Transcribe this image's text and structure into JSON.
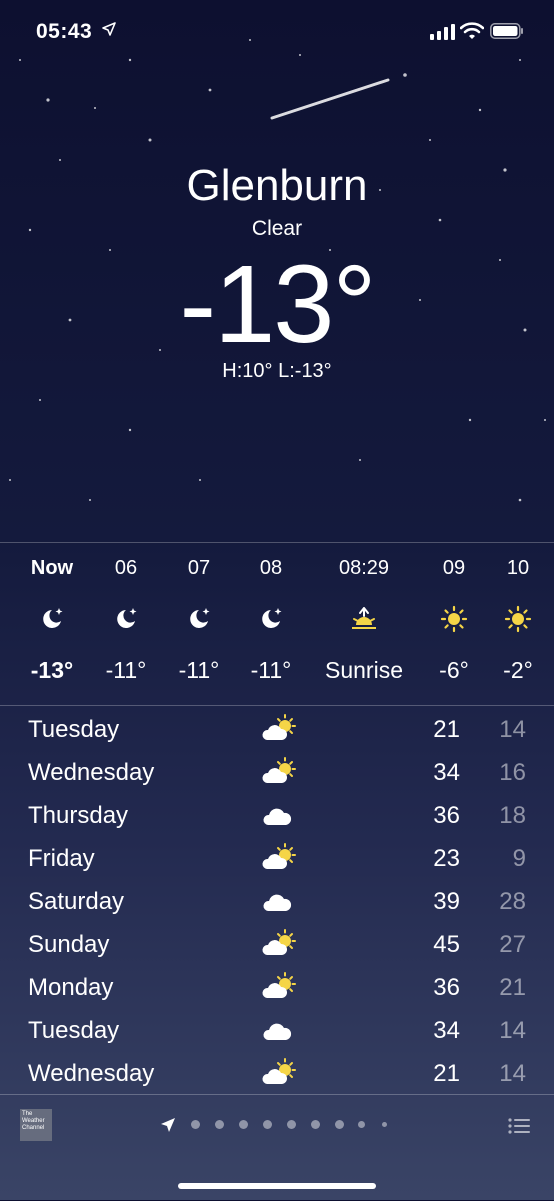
{
  "status_bar": {
    "time": "05:43"
  },
  "location": {
    "city": "Glenburn",
    "condition": "Clear",
    "temperature": "-13°",
    "high_low": "H:10°  L:-13°"
  },
  "hourly": [
    {
      "time": "Now",
      "icon": "moon-stars-icon",
      "temp": "-13°",
      "bold": true
    },
    {
      "time": "06",
      "icon": "moon-stars-icon",
      "temp": "-11°"
    },
    {
      "time": "07",
      "icon": "moon-stars-icon",
      "temp": "-11°"
    },
    {
      "time": "08",
      "icon": "moon-stars-icon",
      "temp": "-11°"
    },
    {
      "time": "08:29",
      "icon": "sunrise-icon",
      "temp": "Sunrise"
    },
    {
      "time": "09",
      "icon": "sun-icon",
      "temp": "-6°"
    },
    {
      "time": "10",
      "icon": "sun-icon",
      "temp": "-2°"
    }
  ],
  "daily": [
    {
      "day": "Tuesday",
      "icon": "partly-cloudy-icon",
      "high": "21",
      "low": "14"
    },
    {
      "day": "Wednesday",
      "icon": "partly-cloudy-icon",
      "high": "34",
      "low": "16"
    },
    {
      "day": "Thursday",
      "icon": "cloud-icon",
      "high": "36",
      "low": "18"
    },
    {
      "day": "Friday",
      "icon": "partly-cloudy-icon",
      "high": "23",
      "low": "9"
    },
    {
      "day": "Saturday",
      "icon": "cloud-icon",
      "high": "39",
      "low": "28"
    },
    {
      "day": "Sunday",
      "icon": "partly-cloudy-icon",
      "high": "45",
      "low": "27"
    },
    {
      "day": "Monday",
      "icon": "partly-cloudy-icon",
      "high": "36",
      "low": "21"
    },
    {
      "day": "Tuesday",
      "icon": "cloud-icon",
      "high": "34",
      "low": "14"
    },
    {
      "day": "Wednesday",
      "icon": "partly-cloudy-icon",
      "high": "21",
      "low": "14"
    }
  ],
  "footer": {
    "logo_text": "The Weather Channel",
    "page_count": 9,
    "current_page": 0
  },
  "colors": {
    "sun": "#f5d547",
    "accent": "#ffffff"
  }
}
